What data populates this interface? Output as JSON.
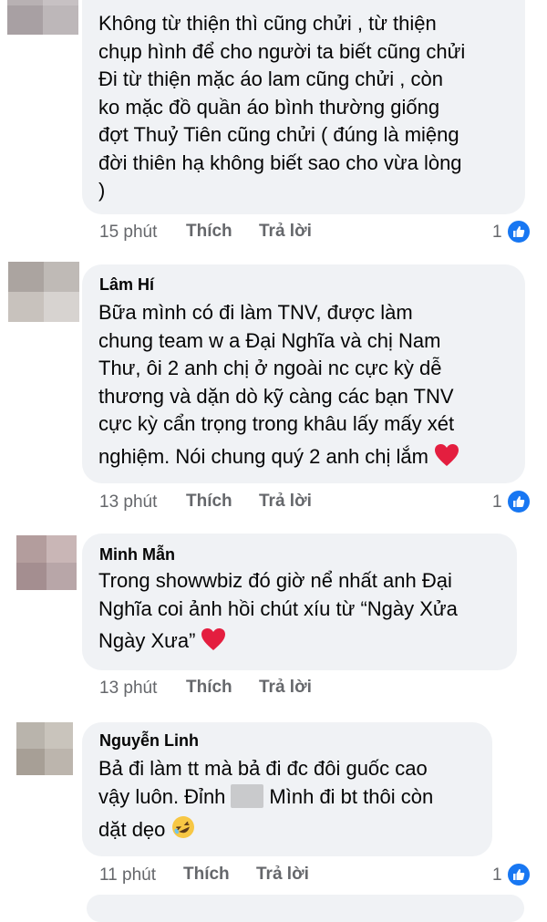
{
  "comments": [
    {
      "author": "",
      "lines": [
        "Không từ thiện thì cũng chửi , từ thiện",
        "chụp hình để cho người ta biết cũng chửi",
        "Đi từ thiện mặc áo lam cũng chửi , còn",
        "ko mặc đồ quần áo bình thường giống",
        "đợt Thuỷ Tiên cũng chửi ( đúng là miệng",
        "đời thiên hạ không biết sao cho vừa lòng",
        ")"
      ],
      "time": "15 phút",
      "like_label": "Thích",
      "reply_label": "Trả lời",
      "reactions": "1"
    },
    {
      "author": "Lâm Hí",
      "lines": [
        "Bữa mình có đi làm TNV, được làm",
        "chung team w a Đại Nghĩa và chị Nam",
        "Thư, ôi 2 anh chị ở ngoài nc cực kỳ dễ",
        "thương và dặn dò kỹ càng các bạn TNV",
        "cực kỳ cẩn trọng trong khâu lấy mấy xét",
        "nghiệm. Nói chung quý 2 anh chị lắm"
      ],
      "time": "13 phút",
      "like_label": "Thích",
      "reply_label": "Trả lời",
      "reactions": "1"
    },
    {
      "author": "Minh Mẫn",
      "lines": [
        "Trong showwbiz đó giờ nể nhất anh Đại",
        "Nghĩa coi ảnh hồi chút xíu từ “Ngày Xửa",
        "Ngày Xưa”"
      ],
      "time": "13 phút",
      "like_label": "Thích",
      "reply_label": "Trả lời",
      "reactions": ""
    },
    {
      "author": "Nguyễn Linh",
      "lines": [
        "Bả đi làm tt mà bả đi đc đôi guốc cao",
        "vậy luôn. Đỉnh",
        "Mình đi bt thôi còn",
        "dặt dẹo"
      ],
      "time": "11 phút",
      "like_label": "Thích",
      "reply_label": "Trả lời",
      "reactions": "1"
    }
  ],
  "colors": {
    "bubble": "#f0f2f5",
    "meta_text": "#65676b",
    "like_blue": "#1877f2",
    "heart_red": "#e41e3f"
  },
  "icons": [
    "thumbs-up-icon",
    "heart-emoji-icon",
    "rofl-emoji-icon",
    "pixelated-avatar"
  ]
}
